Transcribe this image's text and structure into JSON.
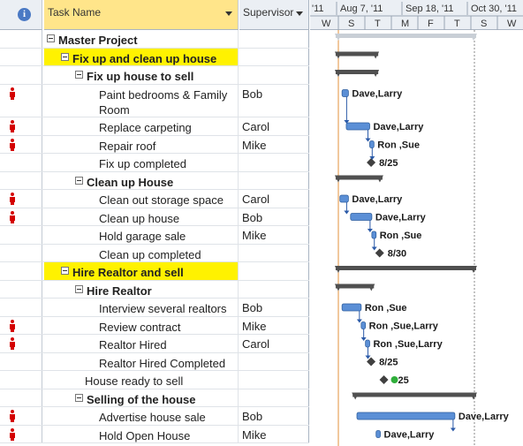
{
  "header": {
    "info_icon": "i",
    "task_name": "Task Name",
    "supervisor": "Supervisor",
    "timescale_top": [
      "'11",
      "Aug 7, '11",
      "Sep 18, '11",
      "Oct 30, '11"
    ],
    "timescale_bottom": [
      "W",
      "S",
      "T",
      "M",
      "F",
      "T",
      "S",
      "W"
    ]
  },
  "rows": [
    {
      "name": "Master Project",
      "supervisor": "",
      "bold": true,
      "indent": 0,
      "summary": true,
      "person": false,
      "highlight": false,
      "lines": 1
    },
    {
      "name": "Fix up and clean up house",
      "supervisor": "",
      "bold": true,
      "indent": 1,
      "summary": true,
      "person": false,
      "highlight": true,
      "lines": 1
    },
    {
      "name": "Fix up house to sell",
      "supervisor": "",
      "bold": true,
      "indent": 2,
      "summary": true,
      "person": false,
      "highlight": false,
      "lines": 1
    },
    {
      "name": "Paint bedrooms & Family",
      "name2": "Room",
      "supervisor": "Bob",
      "bold": false,
      "indent": 3,
      "summary": false,
      "person": true,
      "highlight": false,
      "lines": 2
    },
    {
      "name": "Replace carpeting",
      "supervisor": "Carol",
      "bold": false,
      "indent": 3,
      "summary": false,
      "person": true,
      "highlight": false,
      "lines": 1
    },
    {
      "name": "Repair roof",
      "supervisor": "Mike",
      "bold": false,
      "indent": 3,
      "summary": false,
      "person": true,
      "highlight": false,
      "lines": 1
    },
    {
      "name": "Fix up completed",
      "supervisor": "",
      "bold": false,
      "indent": 3,
      "summary": false,
      "person": false,
      "highlight": false,
      "lines": 1
    },
    {
      "name": "Clean up House",
      "supervisor": "",
      "bold": true,
      "indent": 2,
      "summary": true,
      "person": false,
      "highlight": false,
      "lines": 1
    },
    {
      "name": "Clean out storage space",
      "supervisor": "Carol",
      "bold": false,
      "indent": 3,
      "summary": false,
      "person": true,
      "highlight": false,
      "lines": 1
    },
    {
      "name": "Clean up house",
      "supervisor": "Bob",
      "bold": false,
      "indent": 3,
      "summary": false,
      "person": true,
      "highlight": false,
      "lines": 1
    },
    {
      "name": "Hold garage sale",
      "supervisor": "Mike",
      "bold": false,
      "indent": 3,
      "summary": false,
      "person": false,
      "highlight": false,
      "lines": 1
    },
    {
      "name": "Clean up completed",
      "supervisor": "",
      "bold": false,
      "indent": 3,
      "summary": false,
      "person": false,
      "highlight": false,
      "lines": 1
    },
    {
      "name": "Hire Realtor and sell",
      "supervisor": "",
      "bold": true,
      "indent": 1,
      "summary": true,
      "person": false,
      "highlight": true,
      "lines": 1
    },
    {
      "name": "Hire Realtor",
      "supervisor": "",
      "bold": true,
      "indent": 2,
      "summary": true,
      "person": false,
      "highlight": false,
      "lines": 1
    },
    {
      "name": "Interview several realtors",
      "supervisor": "Bob",
      "bold": false,
      "indent": 3,
      "summary": false,
      "person": false,
      "highlight": false,
      "lines": 1
    },
    {
      "name": "Review contract",
      "supervisor": "Mike",
      "bold": false,
      "indent": 3,
      "summary": false,
      "person": true,
      "highlight": false,
      "lines": 1
    },
    {
      "name": "Realtor Hired",
      "supervisor": "Carol",
      "bold": false,
      "indent": 3,
      "summary": false,
      "person": true,
      "highlight": false,
      "lines": 1
    },
    {
      "name": "Realtor Hired Completed",
      "supervisor": "",
      "bold": false,
      "indent": 3,
      "summary": false,
      "person": false,
      "highlight": false,
      "lines": 1
    },
    {
      "name": "House ready to sell",
      "supervisor": "",
      "bold": false,
      "indent": 2,
      "summary": false,
      "person": false,
      "highlight": false,
      "lines": 1
    },
    {
      "name": "Selling of the house",
      "supervisor": "",
      "bold": true,
      "indent": 2,
      "summary": true,
      "person": false,
      "highlight": false,
      "lines": 1
    },
    {
      "name": "Advertise house sale",
      "supervisor": "Bob",
      "bold": false,
      "indent": 3,
      "summary": false,
      "person": true,
      "highlight": false,
      "lines": 1
    },
    {
      "name": "Hold Open House",
      "supervisor": "Mike",
      "bold": false,
      "indent": 3,
      "summary": false,
      "person": true,
      "highlight": false,
      "lines": 1
    }
  ],
  "gantt": {
    "bars": [
      {
        "row": 0,
        "kind": "summary-light",
        "start": 0.12,
        "end": 0.78
      },
      {
        "row": 1,
        "kind": "summary",
        "start": 0.12,
        "end": 0.32
      },
      {
        "row": 2,
        "kind": "summary",
        "start": 0.12,
        "end": 0.32
      },
      {
        "row": 3,
        "kind": "task",
        "start": 0.15,
        "end": 0.18,
        "label": "Dave,Larry"
      },
      {
        "row": 4,
        "kind": "task",
        "start": 0.17,
        "end": 0.28,
        "label": "Dave,Larry"
      },
      {
        "row": 5,
        "kind": "task",
        "start": 0.28,
        "end": 0.3,
        "label": "Ron ,Sue"
      },
      {
        "row": 6,
        "kind": "milestone",
        "start": 0.27,
        "label": "8/25"
      },
      {
        "row": 7,
        "kind": "summary",
        "start": 0.12,
        "end": 0.34
      },
      {
        "row": 8,
        "kind": "task",
        "start": 0.14,
        "end": 0.18,
        "label": "Dave,Larry"
      },
      {
        "row": 9,
        "kind": "task",
        "start": 0.19,
        "end": 0.29,
        "label": "Dave,Larry"
      },
      {
        "row": 10,
        "kind": "task",
        "start": 0.29,
        "end": 0.31,
        "label": "Ron ,Sue"
      },
      {
        "row": 11,
        "kind": "milestone",
        "start": 0.31,
        "label": "8/30"
      },
      {
        "row": 12,
        "kind": "summary",
        "start": 0.12,
        "end": 0.78
      },
      {
        "row": 13,
        "kind": "summary",
        "start": 0.12,
        "end": 0.3
      },
      {
        "row": 14,
        "kind": "task",
        "start": 0.15,
        "end": 0.24,
        "label": "Ron ,Sue"
      },
      {
        "row": 15,
        "kind": "task",
        "start": 0.24,
        "end": 0.26,
        "label": "Ron ,Sue,Larry"
      },
      {
        "row": 16,
        "kind": "task",
        "start": 0.26,
        "end": 0.28,
        "label": "Ron ,Sue,Larry"
      },
      {
        "row": 17,
        "kind": "milestone",
        "start": 0.27,
        "label": "8/25"
      },
      {
        "row": 18,
        "kind": "milestone-green",
        "start": 0.33,
        "label": "25"
      },
      {
        "row": 19,
        "kind": "summary",
        "start": 0.2,
        "end": 0.78
      },
      {
        "row": 20,
        "kind": "task",
        "start": 0.22,
        "end": 0.68,
        "label": "Dave,Larry"
      },
      {
        "row": 21,
        "kind": "task",
        "start": 0.31,
        "end": 0.33,
        "label": "Dave,Larry"
      }
    ]
  },
  "colors": {
    "highlight": "#fff200",
    "header_selected": "#ffe58a",
    "task_bar": "#5b8fd6",
    "summary_bar": "#505050",
    "person_icon": "#d40000",
    "link_arrow": "#2b5aa8"
  }
}
